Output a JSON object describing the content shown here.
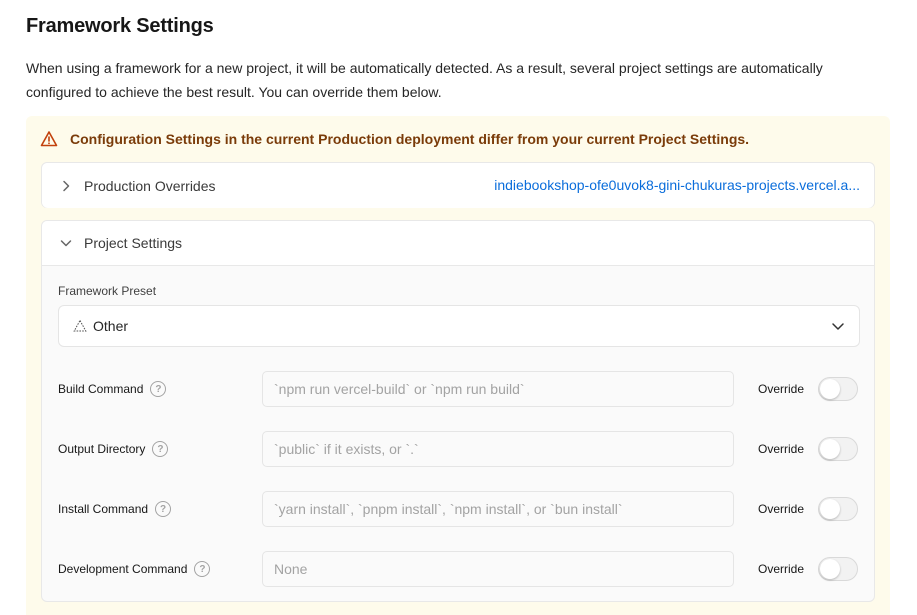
{
  "header": {
    "title": "Framework Settings",
    "description": "When using a framework for a new project, it will be automatically detected. As a result, several project settings are automatically configured to achieve the best result. You can override them below."
  },
  "warning": {
    "icon": "warning-triangle-icon",
    "text": "Configuration Settings in the current Production deployment differ from your current Project Settings.",
    "color": "#7a3b09",
    "background": "#fefbeb"
  },
  "production_overrides": {
    "label": "Production Overrides",
    "link": "indiebookshop-ofe0uvok8-gini-chukuras-projects.vercel.a...",
    "expanded": false
  },
  "project_settings": {
    "label": "Project Settings",
    "expanded": true,
    "framework_preset": {
      "label": "Framework Preset",
      "value": "Other",
      "icon": "triangle-outline-icon"
    },
    "override_label": "Override",
    "fields": [
      {
        "label": "Build Command",
        "placeholder": "`npm run vercel-build` or `npm run build`",
        "value": "",
        "override": false
      },
      {
        "label": "Output Directory",
        "placeholder": "`public` if it exists, or `.`",
        "value": "",
        "override": false
      },
      {
        "label": "Install Command",
        "placeholder": "`yarn install`, `pnpm install`, `npm install`, or `bun install`",
        "value": "",
        "override": false
      },
      {
        "label": "Development Command",
        "placeholder": "None",
        "value": "",
        "override": false
      }
    ]
  },
  "colors": {
    "link": "#0a6ddb",
    "accent_warning": "#c2410c"
  }
}
